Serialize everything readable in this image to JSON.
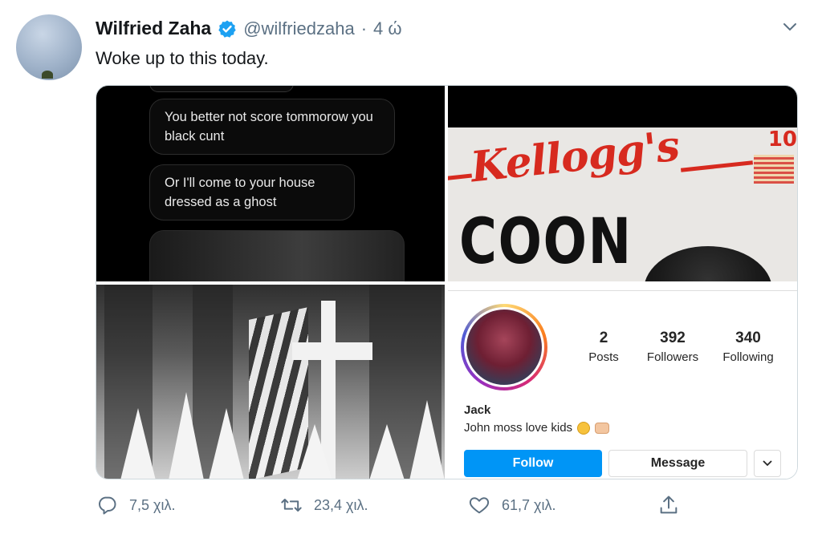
{
  "tweet": {
    "author_name": "Wilfried Zaha",
    "handle": "@wilfriedzaha",
    "separator": "·",
    "time": "4 ώ",
    "text": "Woke up to this today."
  },
  "media": {
    "messages": [
      "You better not score tommorow you black cunt",
      "Or I'll come to your house dressed as a ghost"
    ],
    "kellogg_logo_text": "Kellogg's",
    "cereal_text": "COON",
    "badge_number": "10",
    "instagram_profile": {
      "posts_count": "2",
      "posts_label": "Posts",
      "followers_count": "392",
      "followers_label": "Followers",
      "following_count": "340",
      "following_label": "Following",
      "name": "Jack",
      "bio": "John moss love kids",
      "follow_button": "Follow",
      "message_button": "Message",
      "brand_color": "#0095f6"
    }
  },
  "actions": {
    "replies": "7,5 χιλ.",
    "retweets": "23,4 χιλ.",
    "likes": "61,7 χιλ."
  },
  "colors": {
    "verified": "#1da1f2",
    "secondary_text": "#5b7083"
  }
}
